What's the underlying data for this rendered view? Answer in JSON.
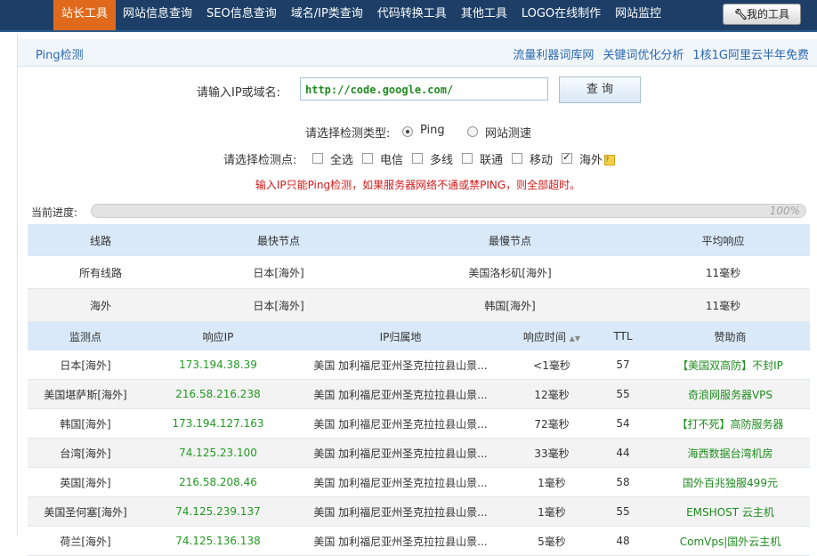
{
  "topbar": {
    "active": "站长工具",
    "items": [
      "网站信息查询",
      "SEO信息查询",
      "域名/IP类查询",
      "代码转换工具",
      "其他工具",
      "LOGO在线制作",
      "网站监控"
    ],
    "my_tools": "我的工具"
  },
  "subhead": {
    "title": "Ping检测",
    "links": [
      "流量利器词库网",
      "关键词优化分析",
      "1核1G阿里云半年免费"
    ]
  },
  "form": {
    "input_label": "请输入IP或域名:",
    "input_value": "http://code.google.com/",
    "query_button": "查 询",
    "type_label": "请选择检测类型:",
    "type_options": [
      "Ping",
      "网站测速"
    ],
    "type_selected": "Ping",
    "node_label": "请选择检测点:",
    "node_options": [
      {
        "label": "全选",
        "checked": false
      },
      {
        "label": "电信",
        "checked": false
      },
      {
        "label": "多线",
        "checked": false
      },
      {
        "label": "联通",
        "checked": false
      },
      {
        "label": "移动",
        "checked": false
      },
      {
        "label": "海外",
        "checked": true
      }
    ],
    "warning": "输入IP只能Ping检测，如果服务器网络不通或禁PING，则全部超时。"
  },
  "progress": {
    "label": "当前进度:",
    "value_percent": 100,
    "text": "100%"
  },
  "summary": {
    "headers": [
      "线路",
      "最快节点",
      "最慢节点",
      "平均响应"
    ],
    "rows": [
      [
        "所有线路",
        "日本[海外]",
        "美国洛杉矶[海外]",
        "11毫秒"
      ],
      [
        "海外",
        "日本[海外]",
        "韩国[海外]",
        "11毫秒"
      ]
    ]
  },
  "detail": {
    "headers": [
      "监测点",
      "响应IP",
      "IP归属地",
      "响应时间",
      "TTL",
      "赞助商"
    ],
    "rows": [
      {
        "node": "日本[海外]",
        "ip": "173.194.38.39",
        "loc": "美国 加利福尼亚州圣克拉拉县山景...",
        "time": "<1毫秒",
        "ttl": "57",
        "sponsor": "【美国双高防】不封IP"
      },
      {
        "node": "美国堪萨斯[海外]",
        "ip": "216.58.216.238",
        "loc": "美国 加利福尼亚州圣克拉拉县山景...",
        "time": "12毫秒",
        "ttl": "55",
        "sponsor": "奇浪网服务器VPS"
      },
      {
        "node": "韩国[海外]",
        "ip": "173.194.127.163",
        "loc": "美国 加利福尼亚州圣克拉拉县山景...",
        "time": "72毫秒",
        "ttl": "54",
        "sponsor": "【打不死】高防服务器"
      },
      {
        "node": "台湾[海外]",
        "ip": "74.125.23.100",
        "loc": "美国 加利福尼亚州圣克拉拉县山景...",
        "time": "33毫秒",
        "ttl": "44",
        "sponsor": "海西数据台湾机房"
      },
      {
        "node": "英国[海外]",
        "ip": "216.58.208.46",
        "loc": "美国 加利福尼亚州圣克拉拉县山景...",
        "time": "1毫秒",
        "ttl": "58",
        "sponsor": "国外百兆独服499元"
      },
      {
        "node": "美国圣何塞[海外]",
        "ip": "74.125.239.137",
        "loc": "美国 加利福尼亚州圣克拉拉县山景...",
        "time": "1毫秒",
        "ttl": "55",
        "sponsor": "EMSHOST 云主机"
      },
      {
        "node": "荷兰[海外]",
        "ip": "74.125.136.138",
        "loc": "美国 加利福尼亚州圣克拉拉县山景...",
        "time": "5毫秒",
        "ttl": "48",
        "sponsor": "ComVps|国外云主机"
      }
    ]
  }
}
